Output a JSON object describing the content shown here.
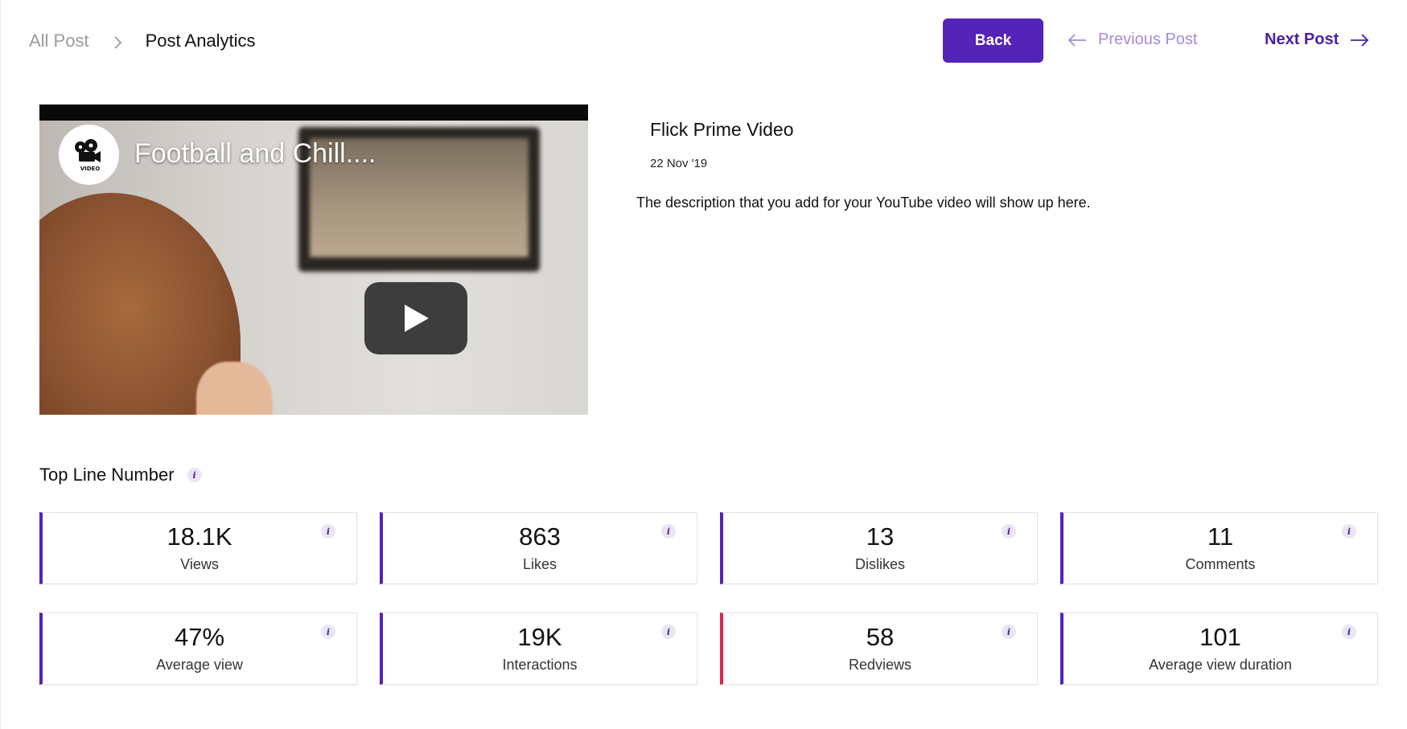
{
  "breadcrumb": {
    "root": "All Post",
    "current": "Post Analytics"
  },
  "header": {
    "back_label": "Back",
    "prev_label": "Previous Post",
    "next_label": "Next Post"
  },
  "video": {
    "title": "Football and Chill....",
    "logo_text": "VIDEO"
  },
  "post": {
    "title": "Flick Prime Video",
    "date": "22 Nov '19",
    "description": "The description that you add for your YouTube video will show up here."
  },
  "section": {
    "title": "Top Line Number",
    "info": "i"
  },
  "stats": [
    {
      "value": "18.1K",
      "label": "Views",
      "accent": "#5423b8"
    },
    {
      "value": "863",
      "label": "Likes",
      "accent": "#5423b8"
    },
    {
      "value": "13",
      "label": "Dislikes",
      "accent": "#5423b8"
    },
    {
      "value": "11",
      "label": "Comments",
      "accent": "#5423b8"
    },
    {
      "value": "47%",
      "label": "Average view",
      "accent": "#5423b8"
    },
    {
      "value": "19K",
      "label": "Interactions",
      "accent": "#5423b8"
    },
    {
      "value": "58",
      "label": "Redviews",
      "accent": "#e0244d"
    },
    {
      "value": "101",
      "label": "Average view duration",
      "accent": "#5423b8"
    }
  ],
  "colors": {
    "primary": "#5423b8",
    "primary_light": "#a78ad6",
    "alert": "#e0244d"
  }
}
